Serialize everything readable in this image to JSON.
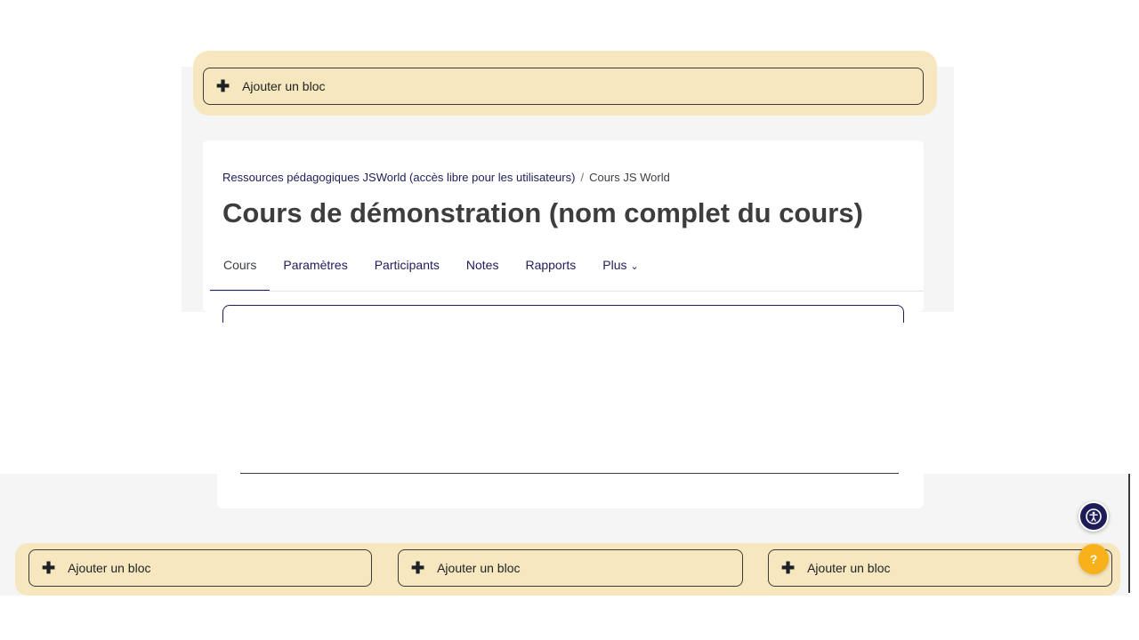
{
  "top_block": {
    "add_label": "Ajouter un bloc",
    "icon": "plus-icon"
  },
  "course": {
    "breadcrumb": [
      "Ressources pédagogiques JSWorld (accès libre pour les utilisateurs)",
      "Cours JS World"
    ],
    "breadcrumb_separator": "/",
    "title": "Cours de démonstration (nom complet du cours)",
    "tabs": [
      {
        "label": "Cours",
        "active": true
      },
      {
        "label": "Paramètres"
      },
      {
        "label": "Participants"
      },
      {
        "label": "Notes"
      },
      {
        "label": "Rapports"
      },
      {
        "label": "Plus"
      }
    ]
  },
  "bottom_blocks": [
    {
      "add_label": "Ajouter un bloc"
    },
    {
      "add_label": "Ajouter un bloc"
    },
    {
      "add_label": "Ajouter un bloc"
    }
  ],
  "floating": {
    "accessibility_icon": "accessibility-icon",
    "help_label": "?"
  },
  "colors": {
    "primary": "#1e1d5a",
    "highlight": "#f7e7bf",
    "help_button": "#f8b118",
    "page_bg": "#f5f5f6"
  }
}
